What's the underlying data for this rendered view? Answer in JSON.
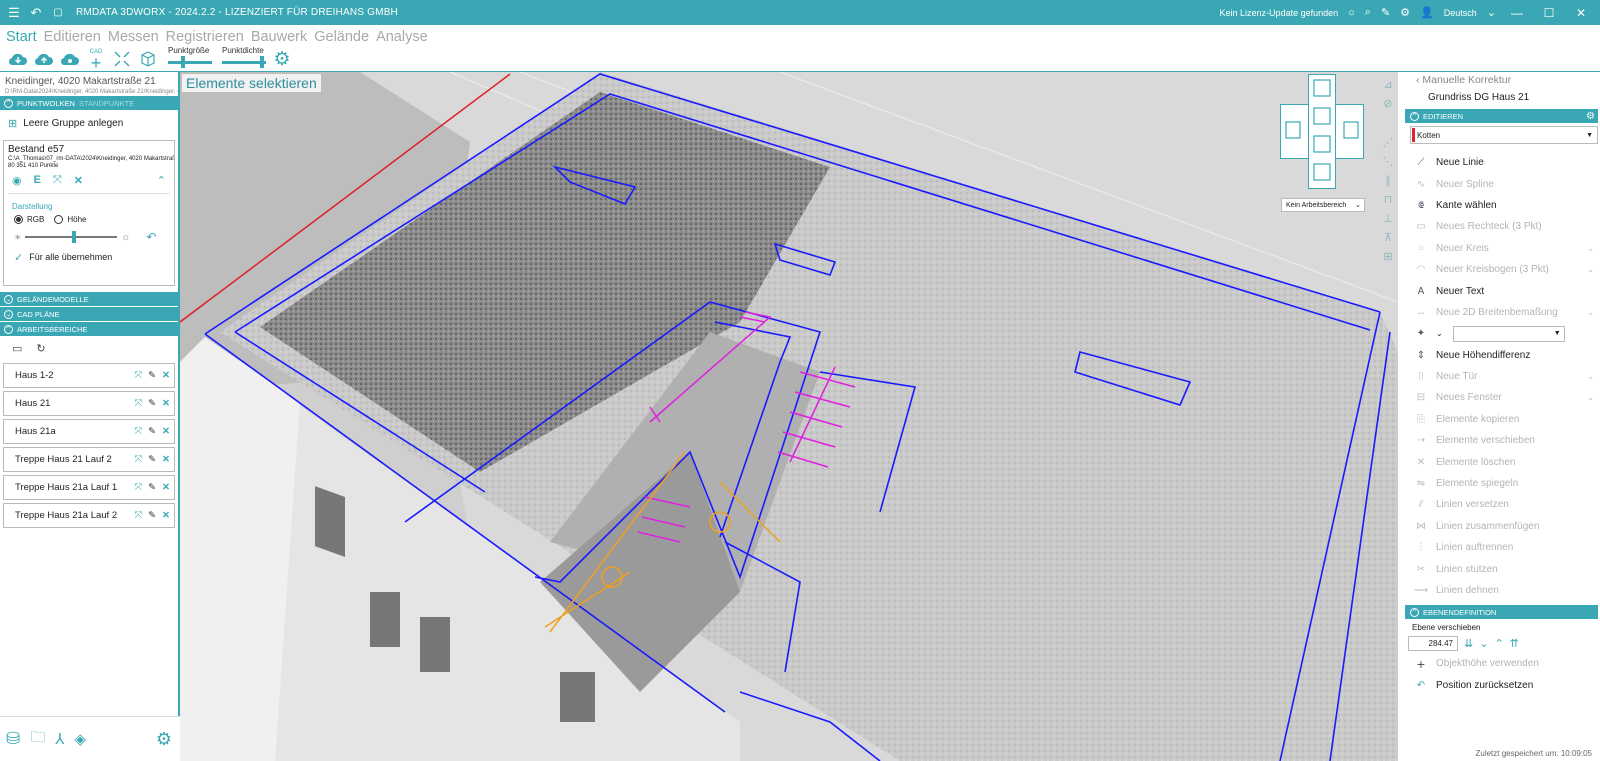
{
  "titlebar": {
    "title": "RMDATA 3DWORX - 2024.2.2 - LIZENZIERT FÜR DREIHANS GMBH",
    "license_status": "Kein Lizenz-Update gefunden",
    "language": "Deutsch"
  },
  "ribbon": {
    "tabs": [
      "Start",
      "Editieren",
      "Messen",
      "Registrieren",
      "Bauwerk",
      "Gelände",
      "Analyse"
    ],
    "cad_badge": "CAD",
    "punktgroesse_label": "Punktgröße",
    "punktdichte_label": "Punktdichte",
    "punktgroesse": 0.3,
    "punktdichte": 0.9
  },
  "left": {
    "project": "Kneidinger, 4020 Makartstraße 21",
    "path": "D:\\RM-Data\\2024\\Kneidinger, 4020 Makartstraße 21\\Kneidinger, 4020",
    "tab_active": "PUNKTWOLKEN",
    "tab_inactive": "STANDPUNKTE",
    "new_group": "Leere Gruppe anlegen",
    "cloud": {
      "name": "Bestand e57",
      "path": "C:\\A_Thomas\\07_rm-DATA\\2024\\Kneidinger, 4020 Makartstraße 21",
      "points": "80 351 410 Punkte",
      "edit_letter": "E"
    },
    "darstellung": "Darstellung",
    "rgb": "RGB",
    "hoehe": "Höhe",
    "apply_all": "Für alle übernehmen",
    "brightness": 0.52,
    "sections": [
      "GELÄNDEMODELLE",
      "CAD PLÄNE",
      "ARBEITSBEREICHE"
    ],
    "areas": [
      "Haus 1-2",
      "Haus 21",
      "Haus 21a",
      "Treppe Haus 21 Lauf 2",
      "Treppe Haus 21a Lauf 1",
      "Treppe Haus 21a Lauf 2"
    ]
  },
  "viewport": {
    "mode_label": "Elementе selektieren",
    "workspace_dropdown": "Kein Arbeitsbereich"
  },
  "right": {
    "back": "Manuelle Korrektur",
    "plan": "Grundriss DG Haus 21",
    "sec_edit": "EDITIEREN",
    "layer": "Kotten",
    "commands": [
      {
        "label": "Neue Linie",
        "enabled": true
      },
      {
        "label": "Neuer Spline",
        "enabled": false
      },
      {
        "label": "Kante wählen",
        "enabled": true
      },
      {
        "label": "Neues Rechteck (3 Pkt)",
        "enabled": false
      },
      {
        "label": "Neuer Kreis",
        "enabled": false
      },
      {
        "label": "Neuer Kreisbogen (3 Pkt)",
        "enabled": false
      },
      {
        "label": "Neuer Text",
        "enabled": true
      },
      {
        "label": "Neue 2D Breitenbemaßung",
        "enabled": false
      },
      {
        "label": "",
        "enabled": true
      },
      {
        "label": "Neue Höhendifferenz",
        "enabled": true
      },
      {
        "label": "Neue Tür",
        "enabled": false
      },
      {
        "label": "Neues Fenster",
        "enabled": false
      },
      {
        "label": "Elemente kopieren",
        "enabled": false
      },
      {
        "label": "Elemente verschieben",
        "enabled": false
      },
      {
        "label": "Elemente löschen",
        "enabled": false
      },
      {
        "label": "Elemente spiegeln",
        "enabled": false
      },
      {
        "label": "Linien versetzen",
        "enabled": false
      },
      {
        "label": "Linien zusammenfügen",
        "enabled": false
      },
      {
        "label": "Linien auftrennen",
        "enabled": false
      },
      {
        "label": "Linien stutzen",
        "enabled": false
      },
      {
        "label": "Linien dehnen",
        "enabled": false
      }
    ],
    "sec_ebene": "EBENENDEFINITION",
    "ebene_label": "Ebene verschieben",
    "ebene_value": "284.47",
    "objekthoehe": "Objekthöhe verwenden",
    "reset": "Position zurücksetzen",
    "saved": "Zuletzt gespeichert um: 10:09:05"
  }
}
